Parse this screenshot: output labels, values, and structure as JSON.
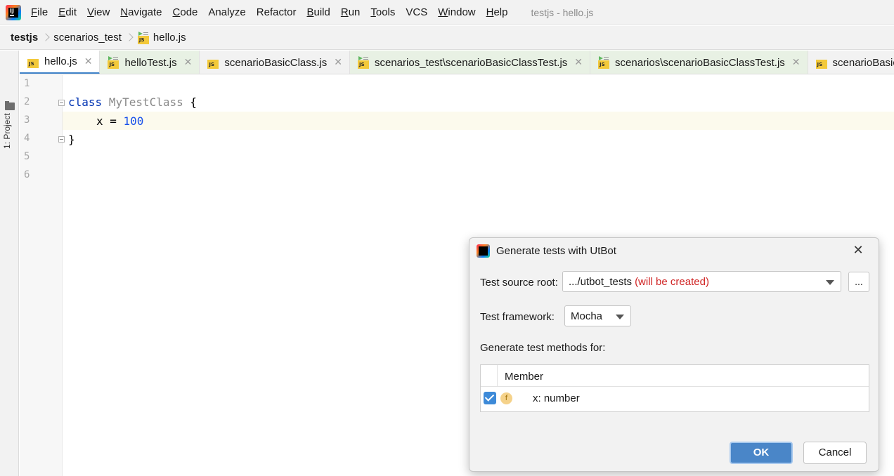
{
  "menu": {
    "items": [
      {
        "mnemonic": "F",
        "rest": "ile"
      },
      {
        "mnemonic": "E",
        "rest": "dit"
      },
      {
        "mnemonic": "V",
        "rest": "iew"
      },
      {
        "mnemonic": "N",
        "rest": "avigate"
      },
      {
        "mnemonic": "C",
        "rest": "ode"
      },
      {
        "mnemonic": "",
        "rest": "Analyze"
      },
      {
        "mnemonic": "",
        "rest": "Refactor"
      },
      {
        "mnemonic": "B",
        "rest": "uild"
      },
      {
        "mnemonic": "R",
        "rest": "un"
      },
      {
        "mnemonic": "T",
        "rest": "ools"
      },
      {
        "mnemonic": "",
        "rest": "VCS"
      },
      {
        "mnemonic": "W",
        "rest": "indow"
      },
      {
        "mnemonic": "H",
        "rest": "elp"
      }
    ],
    "window_title": "testjs - hello.js"
  },
  "breadcrumb": {
    "project": "testjs",
    "folder": "scenarios_test",
    "file": "hello.js"
  },
  "toolstrip": {
    "project_label": "1: Project"
  },
  "tabs": [
    {
      "label": "hello.js",
      "active": true,
      "tested": false
    },
    {
      "label": "helloTest.js",
      "active": false,
      "tested": true
    },
    {
      "label": "scenarioBasicClass.js",
      "active": false,
      "tested": false
    },
    {
      "label": "scenarios_test\\scenarioBasicClassTest.js",
      "active": false,
      "tested": true
    },
    {
      "label": "scenarios\\scenarioBasicClassTest.js",
      "active": false,
      "tested": true
    },
    {
      "label": "scenarioBasicToplevel.js",
      "active": false,
      "tested": false
    }
  ],
  "editor": {
    "line_numbers": [
      "1",
      "2",
      "3",
      "4",
      "5",
      "6"
    ],
    "code": {
      "line2_keyword": "class",
      "line2_classname": "MyTestClass",
      "line2_brace": "{",
      "line3_field": "x = ",
      "line3_value": "100",
      "line4_brace": "}"
    }
  },
  "dialog": {
    "title": "Generate tests with UtBot",
    "close_symbol": "✕",
    "test_source_root_label": "Test source root:",
    "test_source_root_value": ".../utbot_tests",
    "test_source_root_note": "(will be created)",
    "browse_label": "...",
    "test_framework_label": "Test framework:",
    "test_framework_value": "Mocha",
    "generate_for_label": "Generate test methods for:",
    "table_header": "Member",
    "members": [
      {
        "checked": true,
        "icon": "f",
        "name": "x: number"
      }
    ],
    "ok_label": "OK",
    "cancel_label": "Cancel"
  },
  "colors": {
    "accent": "#4a86c8",
    "active_tab_underline": "#4083c9",
    "tested_tab_bg": "#e8f1e4",
    "note_red": "#d02424",
    "keyword_blue": "#0033b3",
    "number_blue": "#1750eb"
  }
}
